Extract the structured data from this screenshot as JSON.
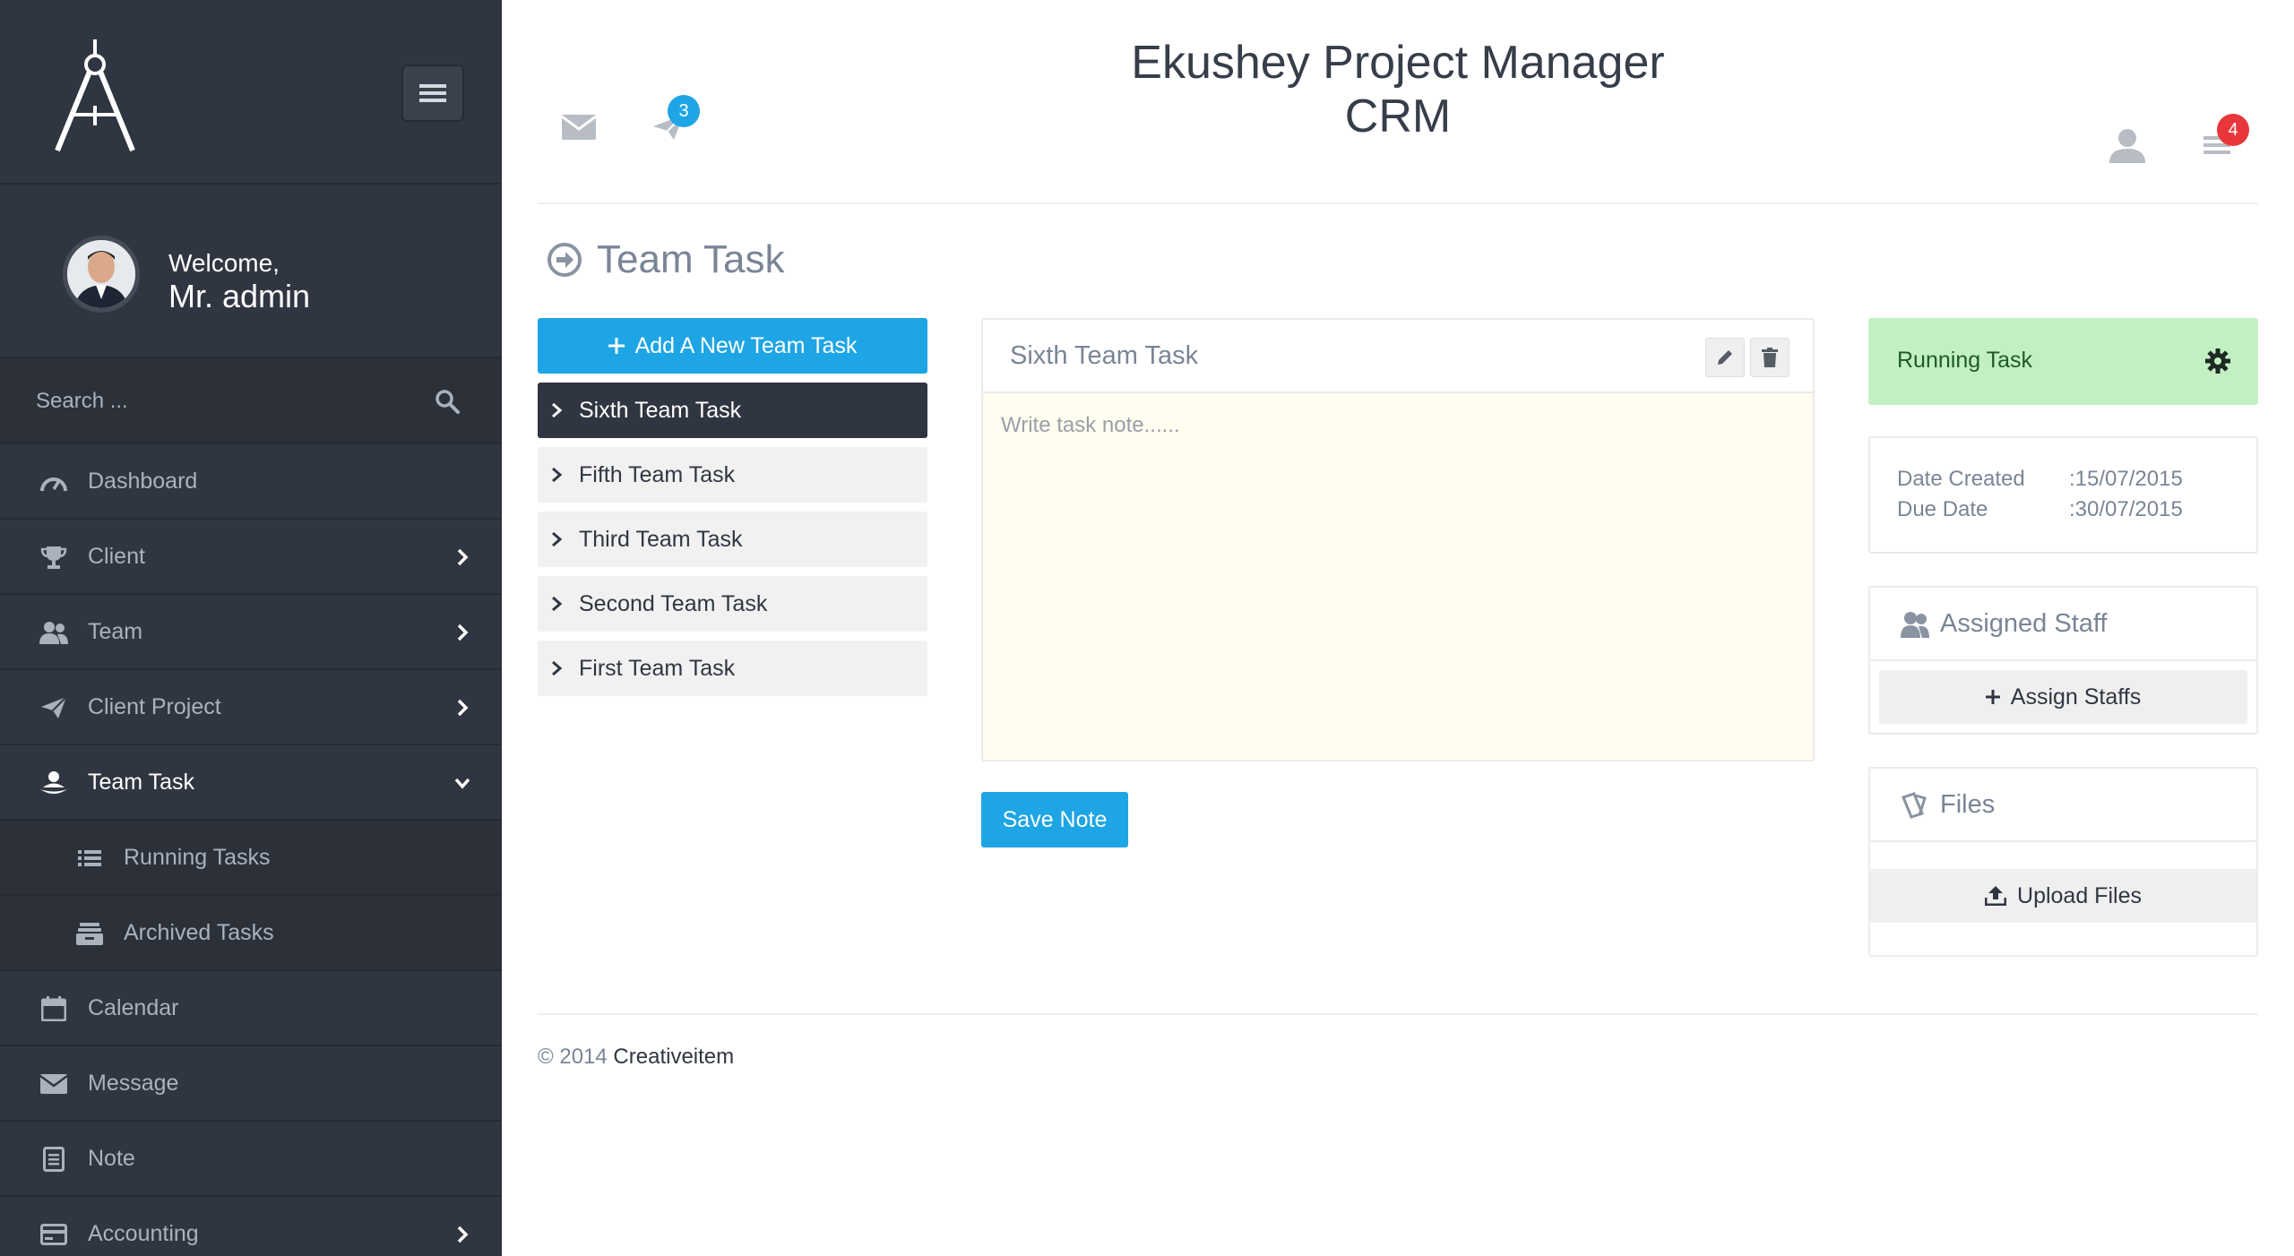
{
  "sidebar": {
    "welcome": "Welcome,",
    "user_name": "Mr. admin",
    "search_placeholder": "Search ...",
    "items": [
      {
        "label": "Dashboard"
      },
      {
        "label": "Client"
      },
      {
        "label": "Team"
      },
      {
        "label": "Client Project"
      },
      {
        "label": "Team Task"
      },
      {
        "label": "Running Tasks"
      },
      {
        "label": "Archived Tasks"
      },
      {
        "label": "Calendar"
      },
      {
        "label": "Message"
      },
      {
        "label": "Note"
      },
      {
        "label": "Accounting"
      }
    ]
  },
  "header": {
    "title": "Ekushey Project Manager CRM",
    "project_badge": "3",
    "menu_badge": "4"
  },
  "page": {
    "title": "Team Task"
  },
  "tasks": {
    "add_label": "Add A New Team Task",
    "items": [
      {
        "label": "Sixth Team Task"
      },
      {
        "label": "Fifth Team Task"
      },
      {
        "label": "Third Team Task"
      },
      {
        "label": "Second Team Task"
      },
      {
        "label": "First Team Task"
      }
    ]
  },
  "note": {
    "title": "Sixth Team Task",
    "placeholder": "Write task note......",
    "save_label": "Save Note"
  },
  "details": {
    "status": "Running Task",
    "date_created_label": "Date Created",
    "date_created": "15/07/2015",
    "due_date_label": "Due Date",
    "due_date": "30/07/2015",
    "staff_title": "Assigned Staff",
    "assign_label": "Assign Staffs",
    "files_title": "Files",
    "upload_label": "Upload Files"
  },
  "footer": {
    "copyright": "© 2014",
    "brand": "Creativeitem"
  },
  "colors": {
    "sidebar": "#303641",
    "accent": "#1ea5e5",
    "status": "#c3f0c3",
    "badge_blue": "#1ea5e5",
    "badge_red": "#e8363a"
  }
}
